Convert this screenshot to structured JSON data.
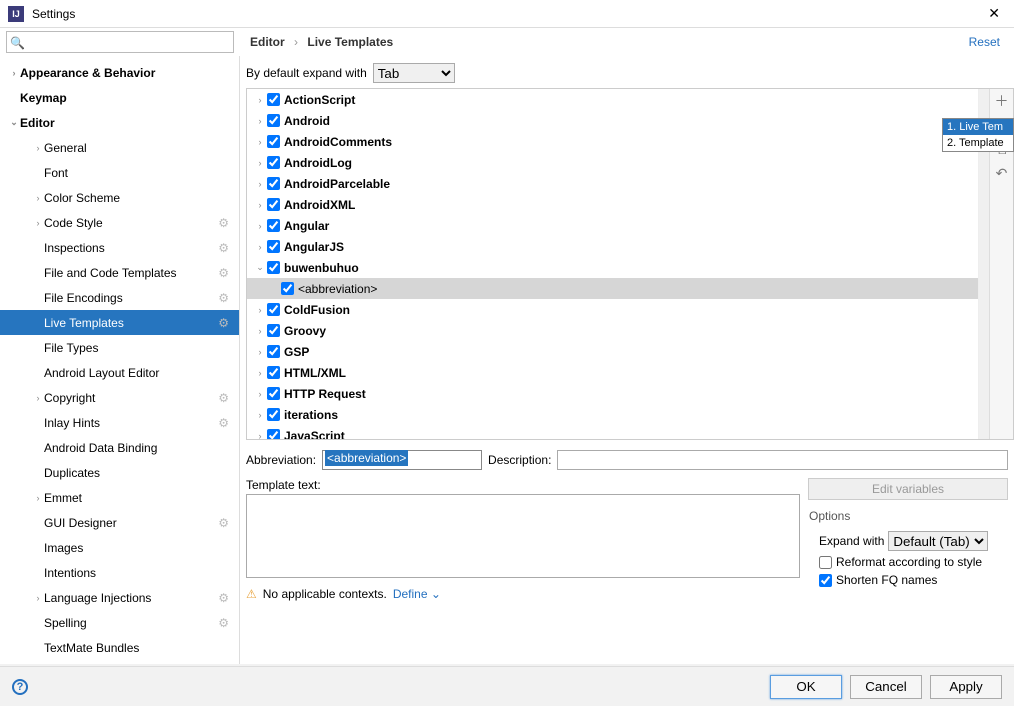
{
  "window": {
    "title": "Settings"
  },
  "breadcrumb": {
    "root": "Editor",
    "leaf": "Live Templates"
  },
  "reset_label": "Reset",
  "expand": {
    "label": "By default expand with",
    "value": "Tab"
  },
  "sidebar": {
    "items": [
      {
        "label": "Appearance & Behavior",
        "level": 1,
        "arrow": ">",
        "bold": true
      },
      {
        "label": "Keymap",
        "level": 1,
        "arrow": "",
        "bold": true
      },
      {
        "label": "Editor",
        "level": 1,
        "arrow": "v",
        "bold": true
      },
      {
        "label": "General",
        "level": 2,
        "arrow": ">",
        "gear": false
      },
      {
        "label": "Font",
        "level": 2,
        "arrow": ""
      },
      {
        "label": "Color Scheme",
        "level": 2,
        "arrow": ">"
      },
      {
        "label": "Code Style",
        "level": 2,
        "arrow": ">",
        "gear": true
      },
      {
        "label": "Inspections",
        "level": 2,
        "arrow": "",
        "gear": true
      },
      {
        "label": "File and Code Templates",
        "level": 2,
        "arrow": "",
        "gear": true
      },
      {
        "label": "File Encodings",
        "level": 2,
        "arrow": "",
        "gear": true
      },
      {
        "label": "Live Templates",
        "level": 2,
        "arrow": "",
        "gear": true,
        "selected": true
      },
      {
        "label": "File Types",
        "level": 2,
        "arrow": ""
      },
      {
        "label": "Android Layout Editor",
        "level": 2,
        "arrow": ""
      },
      {
        "label": "Copyright",
        "level": 2,
        "arrow": ">",
        "gear": true
      },
      {
        "label": "Inlay Hints",
        "level": 2,
        "arrow": "",
        "gear": true
      },
      {
        "label": "Android Data Binding",
        "level": 2,
        "arrow": ""
      },
      {
        "label": "Duplicates",
        "level": 2,
        "arrow": ""
      },
      {
        "label": "Emmet",
        "level": 2,
        "arrow": ">"
      },
      {
        "label": "GUI Designer",
        "level": 2,
        "arrow": "",
        "gear": true
      },
      {
        "label": "Images",
        "level": 2,
        "arrow": ""
      },
      {
        "label": "Intentions",
        "level": 2,
        "arrow": ""
      },
      {
        "label": "Language Injections",
        "level": 2,
        "arrow": ">",
        "gear": true
      },
      {
        "label": "Spelling",
        "level": 2,
        "arrow": "",
        "gear": true
      },
      {
        "label": "TextMate Bundles",
        "level": 2,
        "arrow": ""
      }
    ]
  },
  "tree": {
    "groups": [
      {
        "label": "ActionScript",
        "expanded": false,
        "checked": true
      },
      {
        "label": "Android",
        "expanded": false,
        "checked": true
      },
      {
        "label": "AndroidComments",
        "expanded": false,
        "checked": true
      },
      {
        "label": "AndroidLog",
        "expanded": false,
        "checked": true
      },
      {
        "label": "AndroidParcelable",
        "expanded": false,
        "checked": true
      },
      {
        "label": "AndroidXML",
        "expanded": false,
        "checked": true
      },
      {
        "label": "Angular",
        "expanded": false,
        "checked": true
      },
      {
        "label": "AngularJS",
        "expanded": false,
        "checked": true
      },
      {
        "label": "buwenbuhuo",
        "expanded": true,
        "checked": true,
        "children": [
          {
            "label": "<abbreviation>",
            "checked": true,
            "selected": true
          }
        ]
      },
      {
        "label": "ColdFusion",
        "expanded": false,
        "checked": true
      },
      {
        "label": "Groovy",
        "expanded": false,
        "checked": true
      },
      {
        "label": "GSP",
        "expanded": false,
        "checked": true
      },
      {
        "label": "HTML/XML",
        "expanded": false,
        "checked": true
      },
      {
        "label": "HTTP Request",
        "expanded": false,
        "checked": true
      },
      {
        "label": "iterations",
        "expanded": false,
        "checked": true
      },
      {
        "label": "JavaScript",
        "expanded": false,
        "checked": true
      }
    ]
  },
  "form": {
    "abbrev_label": "Abbreviation:",
    "abbrev_value": "<abbreviation>",
    "desc_label": "Description:",
    "desc_value": "",
    "template_label": "Template text:",
    "editvars_label": "Edit variables",
    "options_title": "Options",
    "expandwith_label": "Expand with",
    "expandwith_value": "Default (Tab)",
    "reformat_label": "Reformat according to style",
    "reformat_checked": false,
    "shorten_label": "Shorten FQ names",
    "shorten_checked": true,
    "context_text": "No applicable contexts.",
    "define_label": "Define"
  },
  "popup": {
    "items": [
      "1. Live Tem",
      "2. Template"
    ]
  },
  "footer": {
    "ok": "OK",
    "cancel": "Cancel",
    "apply": "Apply"
  }
}
